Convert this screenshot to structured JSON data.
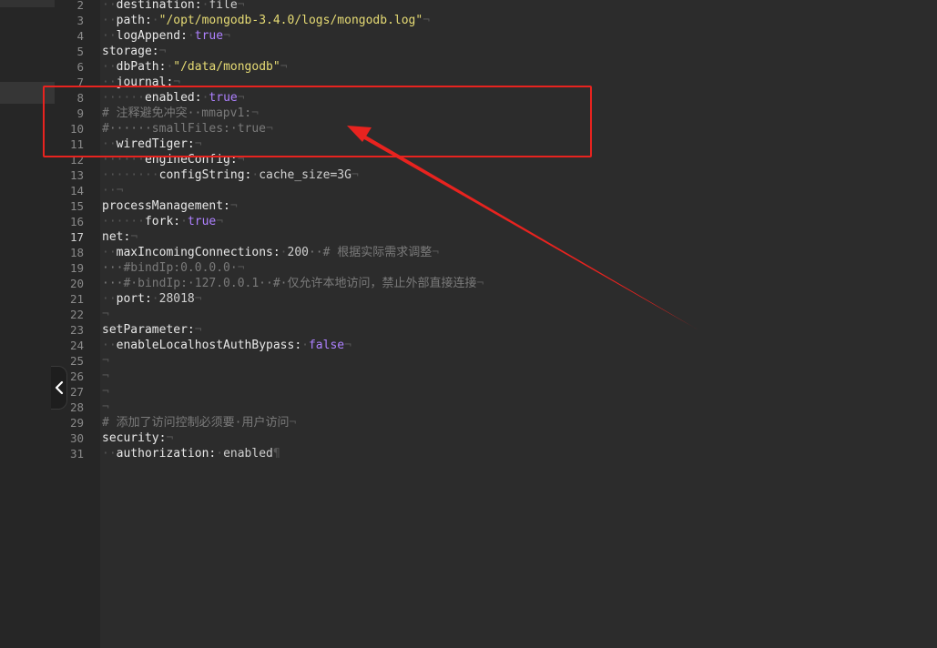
{
  "colors": {
    "annotation": "#e8231f",
    "string": "#e6db74",
    "keyword": "#ae81ff",
    "comment": "#7a7a7a"
  },
  "icons": {
    "collapse": "chevron-left-icon"
  },
  "lines": [
    {
      "n": "2",
      "indent": "··",
      "key": "destination:",
      "value": "file",
      "vt": "val",
      "eol": "¬"
    },
    {
      "n": "3",
      "indent": "··",
      "key": "path:",
      "value": "\"/opt/mongodb-3.4.0/logs/mongodb.log\"",
      "vt": "str",
      "eol": "¬"
    },
    {
      "n": "4",
      "indent": "··",
      "key": "logAppend:",
      "value": "true",
      "vt": "kw",
      "eol": "¬"
    },
    {
      "n": "5",
      "indent": "",
      "key": "storage:",
      "value": "",
      "vt": "val",
      "eol": "¬"
    },
    {
      "n": "6",
      "indent": "··",
      "key": "dbPath:",
      "value": "\"/data/mongodb\"",
      "vt": "str",
      "eol": "¬"
    },
    {
      "n": "7",
      "indent": "··",
      "key": "journal:",
      "value": "",
      "vt": "val",
      "eol": "¬"
    },
    {
      "n": "8",
      "indent": "······",
      "key": "enabled:",
      "value": "true",
      "vt": "kw",
      "eol": "¬"
    },
    {
      "n": "9",
      "indent": "",
      "comment": "# 注释避免冲突··mmapv1:",
      "eol": "¬"
    },
    {
      "n": "10",
      "indent": "",
      "comment": "#······smallFiles:·true",
      "eol": "¬"
    },
    {
      "n": "11",
      "indent": "··",
      "key": "wiredTiger:",
      "value": "",
      "vt": "val",
      "eol": "¬"
    },
    {
      "n": "12",
      "indent": "······",
      "key": "engineConfig:",
      "value": "",
      "vt": "val",
      "eol": "¬"
    },
    {
      "n": "13",
      "indent": "········",
      "key": "configString:",
      "value": "cache_size=3G",
      "vt": "val",
      "eol": "¬"
    },
    {
      "n": "14",
      "indent": "··",
      "key": "",
      "value": "",
      "vt": "val",
      "eol": "¬"
    },
    {
      "n": "15",
      "indent": "",
      "key": "processManagement:",
      "value": "",
      "vt": "val",
      "eol": "¬"
    },
    {
      "n": "16",
      "indent": "······",
      "key": "fork:",
      "value": "true",
      "vt": "kw",
      "eol": "¬"
    },
    {
      "n": "17",
      "indent": "",
      "key": "net:",
      "value": "",
      "vt": "val",
      "eol": "¬",
      "current": true
    },
    {
      "n": "18",
      "indent": "··",
      "key": "maxIncomingConnections:",
      "value": "200",
      "vt": "val",
      "trail": "··# 根据实际需求调整",
      "eol": "¬"
    },
    {
      "n": "19",
      "indent": "",
      "comment": "···#bindIp:0.0.0.0·",
      "eol": "¬"
    },
    {
      "n": "20",
      "indent": "",
      "comment": "···#·bindIp:·127.0.0.1··#·仅允许本地访问，禁止外部直接连接",
      "eol": "¬"
    },
    {
      "n": "21",
      "indent": "··",
      "key": "port:",
      "value": "28018",
      "vt": "val",
      "eol": "¬"
    },
    {
      "n": "22",
      "indent": "",
      "key": "",
      "value": "",
      "vt": "val",
      "eol": "¬"
    },
    {
      "n": "23",
      "indent": "",
      "key": "setParameter:",
      "value": "",
      "vt": "val",
      "eol": "¬"
    },
    {
      "n": "24",
      "indent": "··",
      "key": "enableLocalhostAuthBypass:",
      "value": "false",
      "vt": "kw",
      "eol": "¬"
    },
    {
      "n": "25",
      "indent": "",
      "key": "",
      "value": "",
      "vt": "val",
      "eol": "¬"
    },
    {
      "n": "26",
      "indent": "",
      "key": "",
      "value": "",
      "vt": "val",
      "eol": "¬"
    },
    {
      "n": "27",
      "indent": "",
      "key": "",
      "value": "",
      "vt": "val",
      "eol": "¬"
    },
    {
      "n": "28",
      "indent": "",
      "key": "",
      "value": "",
      "vt": "val",
      "eol": "¬"
    },
    {
      "n": "29",
      "indent": "",
      "comment": "# 添加了访问控制必须要·用户访问",
      "eol": "¬"
    },
    {
      "n": "30",
      "indent": "",
      "key": "security:",
      "value": "",
      "vt": "val",
      "eol": "¬"
    },
    {
      "n": "31",
      "indent": "··",
      "key": "authorization:",
      "value": "enabled",
      "vt": "val",
      "eol": "¶"
    }
  ]
}
